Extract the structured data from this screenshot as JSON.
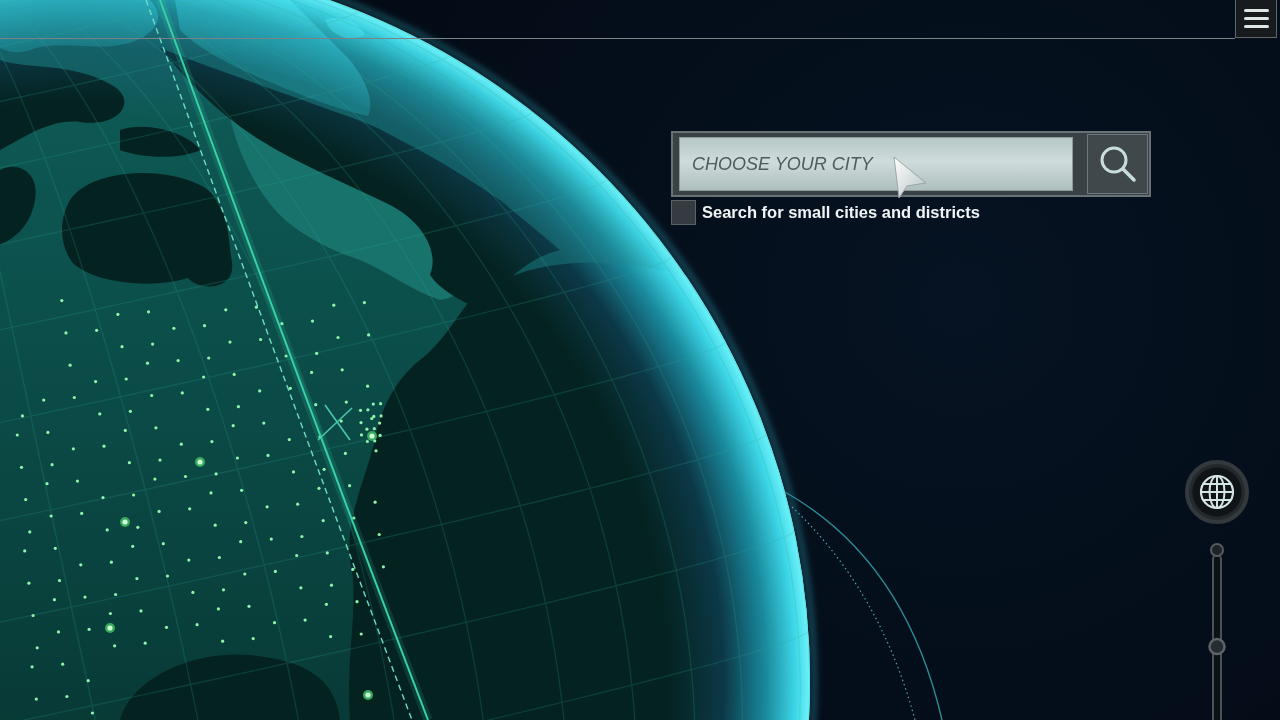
{
  "search": {
    "placeholder": "CHOOSE YOUR CITY"
  },
  "small_cities_option": {
    "label": "Search for small cities and districts",
    "checked": false
  },
  "vertical_slider": {
    "level": 0.44
  }
}
